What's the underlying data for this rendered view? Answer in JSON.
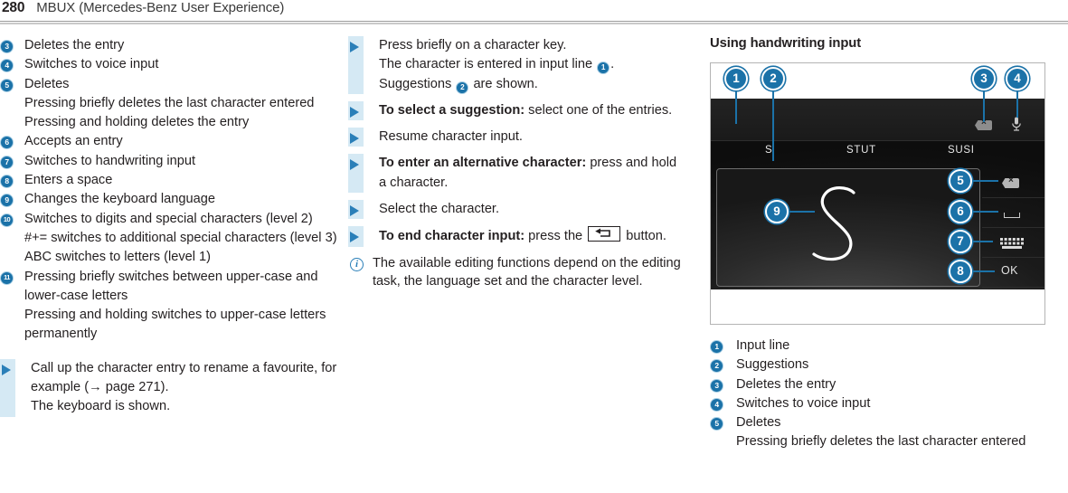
{
  "header": {
    "page_number": "280",
    "chapter_title": "MBUX (Mercedes-Benz User Experience)"
  },
  "left_column": {
    "items": [
      {
        "num": "3",
        "text": "Deletes the entry"
      },
      {
        "num": "4",
        "text": "Switches to voice input"
      },
      {
        "num": "5",
        "text": "Deletes",
        "subs": [
          "Pressing briefly deletes the last character entered",
          "Pressing and holding deletes the entry"
        ]
      },
      {
        "num": "6",
        "text": "Accepts an entry"
      },
      {
        "num": "7",
        "text": "Switches to handwriting input"
      },
      {
        "num": "8",
        "text": "Enters a space"
      },
      {
        "num": "9",
        "text": "Changes the keyboard language"
      },
      {
        "num": "10",
        "text": "Switches to digits and special characters (level 2)",
        "subs": [
          "#+= switches to additional special characters (level 3)",
          "ABC switches to letters (level 1)"
        ]
      },
      {
        "num": "11",
        "text": "Pressing briefly switches between upper-case and lower-case letters",
        "subs": [
          "Pressing and holding switches to upper-case letters permanently"
        ]
      }
    ],
    "step": {
      "line1": "Call up the character entry to rename a favourite, for example (→ page 271).",
      "line2": "The keyboard is shown."
    }
  },
  "mid_column": {
    "steps": [
      {
        "bold": "",
        "text": "Press briefly on a character key.",
        "line2_a": "The character is entered in input line ",
        "line2_badge": "1",
        "line2_b": ".",
        "line3_a": "Suggestions ",
        "line3_badge": "2",
        "line3_b": " are shown."
      },
      {
        "bold": "To select a suggestion:",
        "text": " select one of the entries."
      },
      {
        "bold": "",
        "text": "Resume character input."
      },
      {
        "bold": "To enter an alternative character:",
        "text": " press and hold a character."
      },
      {
        "bold": "",
        "text": "Select the character."
      },
      {
        "bold": "To end character input:",
        "text_before": " press the ",
        "key_icon": "back-button-icon",
        "text_after": " button."
      }
    ],
    "note": "The available editing functions depend on the editing task, the language set and the character level."
  },
  "right_column": {
    "heading": "Using handwriting input",
    "figure": {
      "suggestions": [
        "S",
        "STUT",
        "SUSI"
      ],
      "handwritten_character": "S",
      "ok_label": "OK",
      "callouts": [
        "1",
        "2",
        "3",
        "4",
        "5",
        "6",
        "7",
        "8",
        "9"
      ],
      "icons": {
        "delete_entry": "delete-backspace-icon",
        "voice": "microphone-icon",
        "hw_delete": "delete-backspace-icon",
        "hw_space": "space-bar-icon",
        "hw_keyboard": "keyboard-icon"
      }
    },
    "legend": [
      {
        "num": "1",
        "text": "Input line"
      },
      {
        "num": "2",
        "text": "Suggestions"
      },
      {
        "num": "3",
        "text": "Deletes the entry"
      },
      {
        "num": "4",
        "text": "Switches to voice input"
      },
      {
        "num": "5",
        "text": "Deletes",
        "subs": [
          "Pressing briefly deletes the last character entered"
        ]
      }
    ]
  },
  "colors": {
    "accent_blue": "#1b72a8",
    "arrow_blue": "#2a7fb8",
    "bluebar": "#d5e9f4",
    "text": "#231f20"
  }
}
